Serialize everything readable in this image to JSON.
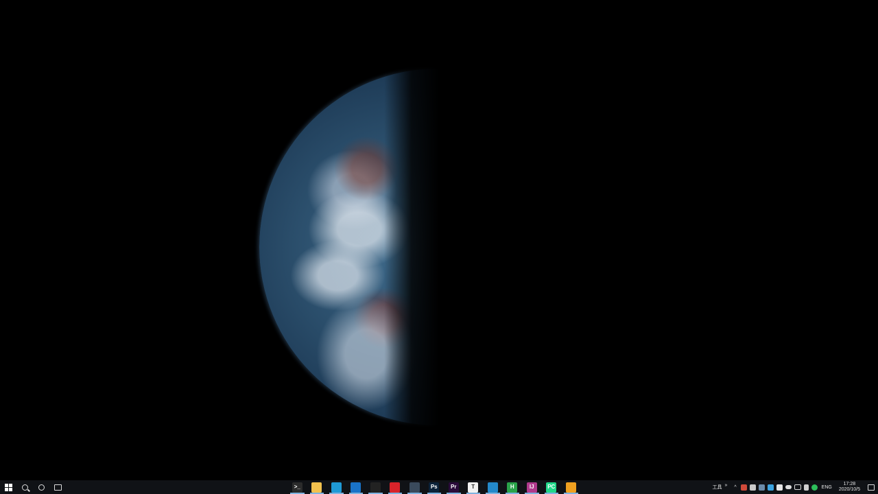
{
  "desktop": {
    "wallpaper": "earth-half-lit-from-space"
  },
  "taskbar": {
    "background": "#101216",
    "left_buttons": [
      {
        "name": "start-button",
        "icon": "windows-logo-icon"
      },
      {
        "name": "search-button",
        "icon": "search-icon"
      },
      {
        "name": "cortana-button",
        "icon": "cortana-circle-icon"
      },
      {
        "name": "task-view-button",
        "icon": "task-view-icon"
      }
    ],
    "pinned_apps": [
      {
        "name": "terminal",
        "icon": "terminal-icon",
        "glyph": ">_",
        "color": "#2b2b2b"
      },
      {
        "name": "file-explorer",
        "icon": "folder-icon",
        "glyph": "",
        "color": "#f2c14e"
      },
      {
        "name": "edge",
        "icon": "edge-icon",
        "glyph": "",
        "color": "#1f9ad6"
      },
      {
        "name": "mail",
        "icon": "mail-icon",
        "glyph": "",
        "color": "#1a73c8"
      },
      {
        "name": "qq",
        "icon": "penguin-icon",
        "glyph": "",
        "color": "#222222"
      },
      {
        "name": "netease-music",
        "icon": "music-icon",
        "glyph": "",
        "color": "#d8232a"
      },
      {
        "name": "steam",
        "icon": "steam-icon",
        "glyph": "",
        "color": "#3a4a5c"
      },
      {
        "name": "photoshop",
        "icon": "photoshop-icon",
        "glyph": "Ps",
        "color": "#0b2239"
      },
      {
        "name": "premiere",
        "icon": "premiere-icon",
        "glyph": "Pr",
        "color": "#2a0b3a"
      },
      {
        "name": "typora",
        "icon": "typora-icon",
        "glyph": "T",
        "color": "#f2f2f2"
      },
      {
        "name": "vscode",
        "icon": "vscode-icon",
        "glyph": "",
        "color": "#2489ca"
      },
      {
        "name": "hbuilder",
        "icon": "hbuilder-icon",
        "glyph": "H",
        "color": "#2aa34a"
      },
      {
        "name": "intellij",
        "icon": "intellij-icon",
        "glyph": "IJ",
        "color": "#b03a8c"
      },
      {
        "name": "pycharm",
        "icon": "pycharm-icon",
        "glyph": "PC",
        "color": "#21d789"
      },
      {
        "name": "windows-app",
        "icon": "window-squares-icon",
        "glyph": "",
        "color": "#f0a020"
      }
    ],
    "tray": {
      "toolbar_label": "工具",
      "toolbar_chevron": "»",
      "language": "ENG",
      "time": "17:28",
      "date": "2020/10/5"
    }
  }
}
